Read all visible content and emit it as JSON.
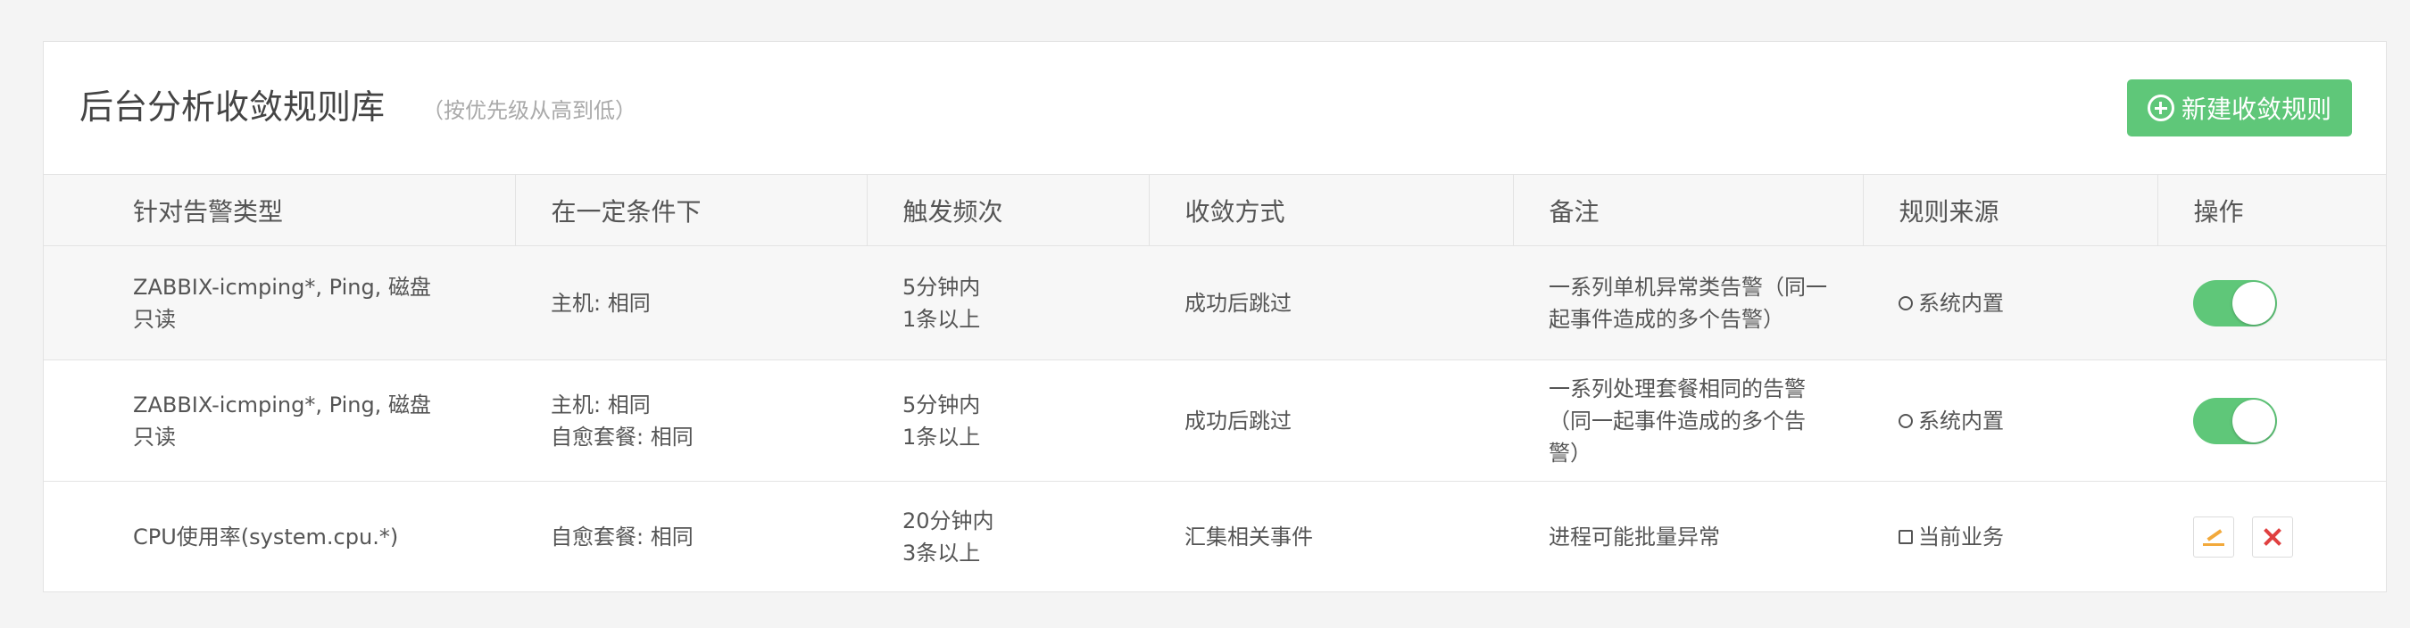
{
  "header": {
    "title": "后台分析收敛规则库",
    "subtitle": "（按优先级从高到低）",
    "new_rule_button": "新建收敛规则"
  },
  "colors": {
    "accent_green": "#5fc779",
    "edit_orange": "#f2a93b",
    "delete_red": "#e04040"
  },
  "table": {
    "headers": [
      "针对告警类型",
      "在一定条件下",
      "触发频次",
      "收敛方式",
      "备注",
      "规则来源",
      "操作"
    ],
    "rows": [
      {
        "alert_type": [
          "ZABBIX-icmping*, Ping, 磁盘",
          "只读"
        ],
        "conditions": [
          "主机: 相同"
        ],
        "frequency": [
          "5分钟内",
          "1条以上"
        ],
        "method": "成功后跳过",
        "remark": [
          "一系列单机异常类告警（同一",
          "起事件造成的多个告警）"
        ],
        "source": "系统内置",
        "source_icon": "circle-icon",
        "enabled": true
      },
      {
        "alert_type": [
          "ZABBIX-icmping*, Ping, 磁盘",
          "只读"
        ],
        "conditions": [
          "主机: 相同",
          "自愈套餐: 相同"
        ],
        "frequency": [
          "5分钟内",
          "1条以上"
        ],
        "method": "成功后跳过",
        "remark": [
          "一系列处理套餐相同的告警",
          "（同一起事件造成的多个告",
          "警）"
        ],
        "source": "系统内置",
        "source_icon": "circle-icon",
        "enabled": true
      },
      {
        "alert_type": [
          "CPU使用率(system.cpu.*)"
        ],
        "conditions": [
          "自愈套餐: 相同"
        ],
        "frequency": [
          "20分钟内",
          "3条以上"
        ],
        "method": "汇集相关事件",
        "remark": [
          "进程可能批量异常"
        ],
        "source": "当前业务",
        "source_icon": "square-icon",
        "actions": [
          "edit-icon",
          "delete-icon"
        ]
      }
    ]
  }
}
